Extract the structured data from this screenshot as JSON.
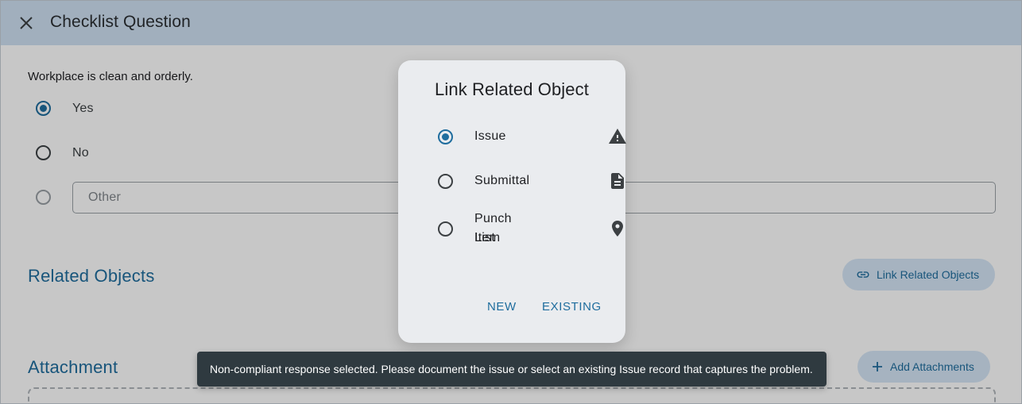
{
  "header": {
    "title": "Checklist Question",
    "close_icon": "close-icon"
  },
  "question": {
    "text": "Workplace is clean and orderly.",
    "options": [
      {
        "label": "Yes",
        "checked": true
      },
      {
        "label": "No",
        "checked": false
      }
    ],
    "other_placeholder": "Other"
  },
  "related_objects": {
    "title": "Related Objects",
    "button_label": "Link Related Objects",
    "icon": "link-icon"
  },
  "attachment": {
    "title": "Attachment",
    "button_label": "Add Attachments",
    "icon": "plus-icon"
  },
  "dialog": {
    "title": "Link Related Object",
    "options": [
      {
        "label": "Issue",
        "checked": true,
        "icon": "warning-icon"
      },
      {
        "label": "Submittal",
        "checked": false,
        "icon": "document-icon"
      },
      {
        "label_line1": "Punch List",
        "label_line2": "Item",
        "checked": false,
        "icon": "location-pin-icon"
      }
    ],
    "new_label": "NEW",
    "existing_label": "EXISTING"
  },
  "snackbar": {
    "message": "Non-compliant response selected. Please document the issue or select an existing Issue record that captures the problem."
  },
  "colors": {
    "accent": "#1f6d9e",
    "header_bg": "#cfe0f2",
    "snackbar_bg": "#2f3a40",
    "pill_bg": "#d5e6f6"
  }
}
